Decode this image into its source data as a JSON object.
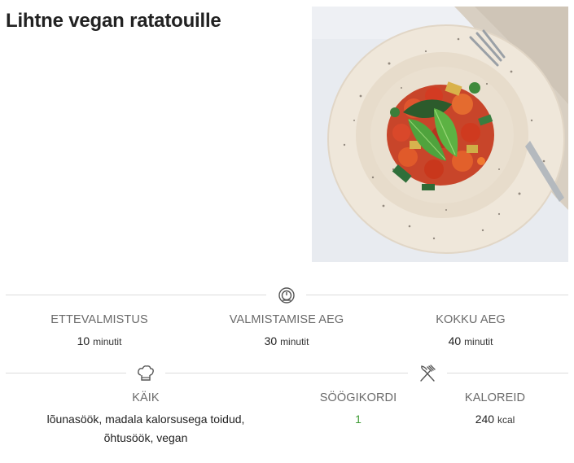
{
  "recipe": {
    "title": "Lihtne vegan ratatouille"
  },
  "times": {
    "prep": {
      "label": "ETTEVALMISTUS",
      "value": "10",
      "unit": "minutit"
    },
    "cook": {
      "label": "VALMISTAMISE AEG",
      "value": "30",
      "unit": "minutit"
    },
    "total": {
      "label": "KOKKU AEG",
      "value": "40",
      "unit": "minutit"
    }
  },
  "details": {
    "course": {
      "label": "KÄIK",
      "value": "lõunasöök, madala kalorsusega toidud, õhtusöök, vegan"
    },
    "servings": {
      "label": "SÖÖGIKORDI",
      "value": "1"
    },
    "calories": {
      "label": "KALOREID",
      "value": "240",
      "unit": "kcal"
    }
  },
  "colors": {
    "servings_value": "#3f9c35",
    "divider": "#dcdcdc"
  },
  "icons": {
    "times": "timer-icon",
    "course": "chef-hat-icon",
    "servings": "fork-knife-icon"
  }
}
